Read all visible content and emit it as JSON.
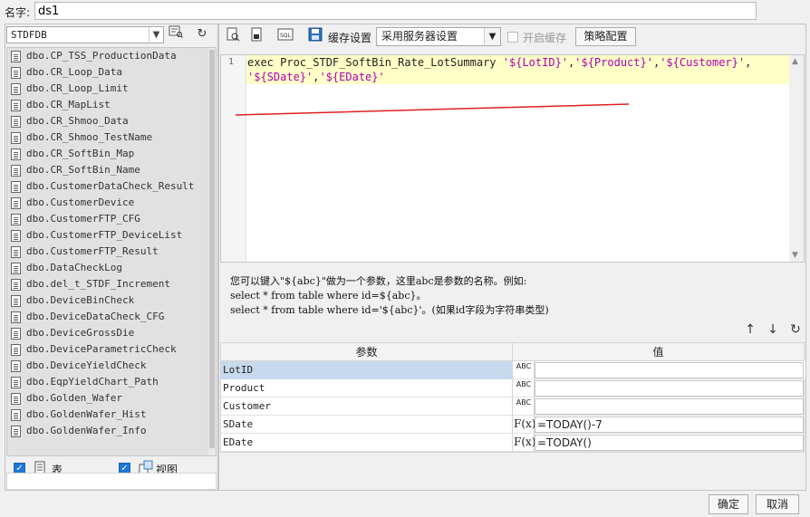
{
  "name_row": {
    "label": "名字:",
    "value": "ds1"
  },
  "left": {
    "db_select": "STDFDB",
    "tables": [
      "dbo.CP_TSS_ProductionData",
      "dbo.CR_Loop_Data",
      "dbo.CR_Loop_Limit",
      "dbo.CR_MapList",
      "dbo.CR_Shmoo_Data",
      "dbo.CR_Shmoo_TestName",
      "dbo.CR_SoftBin_Map",
      "dbo.CR_SoftBin_Name",
      "dbo.CustomerDataCheck_Result",
      "dbo.CustomerDevice",
      "dbo.CustomerFTP_CFG",
      "dbo.CustomerFTP_DeviceList",
      "dbo.CustomerFTP_Result",
      "dbo.DataCheckLog",
      "dbo.del_t_STDF_Increment",
      "dbo.DeviceBinCheck",
      "dbo.DeviceDataCheck_CFG",
      "dbo.DeviceGrossDie",
      "dbo.DeviceParametricCheck",
      "dbo.DeviceYieldCheck",
      "dbo.EqpYieldChart_Path",
      "dbo.Golden_Wafer",
      "dbo.GoldenWafer_Hist",
      "dbo.GoldenWafer_Info"
    ],
    "checkbox_table_label": "表",
    "checkbox_view_label": "视图"
  },
  "right": {
    "cache_label": "缓存设置",
    "cache_select": "采用服务器设置",
    "enable_cache_label": "开启缓存",
    "strategy_button": "策略配置",
    "editor": {
      "line_number": "1",
      "line1_prefix": "exec Proc_STDF_SoftBin_Rate_LotSummary ",
      "line1_p1": "'${LotID}'",
      "line1_p2": "'${Product}'",
      "line1_p3": "'${Customer}'",
      "comma": ",",
      "line2_p1": "'${SDate}'",
      "line2_p2": "'${EDate}'"
    },
    "hint": {
      "line1": "您可以键入\"${abc}\"做为一个参数，这里abc是参数的名称。例如:",
      "line2": "select * from table where id=${abc}。",
      "line3": "select * from table where id='${abc}'。(如果id字段为字符串类型)"
    },
    "params": {
      "header_name": "参数",
      "header_value": "值",
      "rows": [
        {
          "name": "LotID",
          "type": "ABC",
          "value": ""
        },
        {
          "name": "Product",
          "type": "ABC",
          "value": ""
        },
        {
          "name": "Customer",
          "type": "ABC",
          "value": ""
        },
        {
          "name": "SDate",
          "type": "F(x)",
          "value": "=TODAY()-7"
        },
        {
          "name": "EDate",
          "type": "F(x)",
          "value": "=TODAY()"
        }
      ]
    }
  },
  "buttons": {
    "ok": "确定",
    "cancel": "取消"
  }
}
